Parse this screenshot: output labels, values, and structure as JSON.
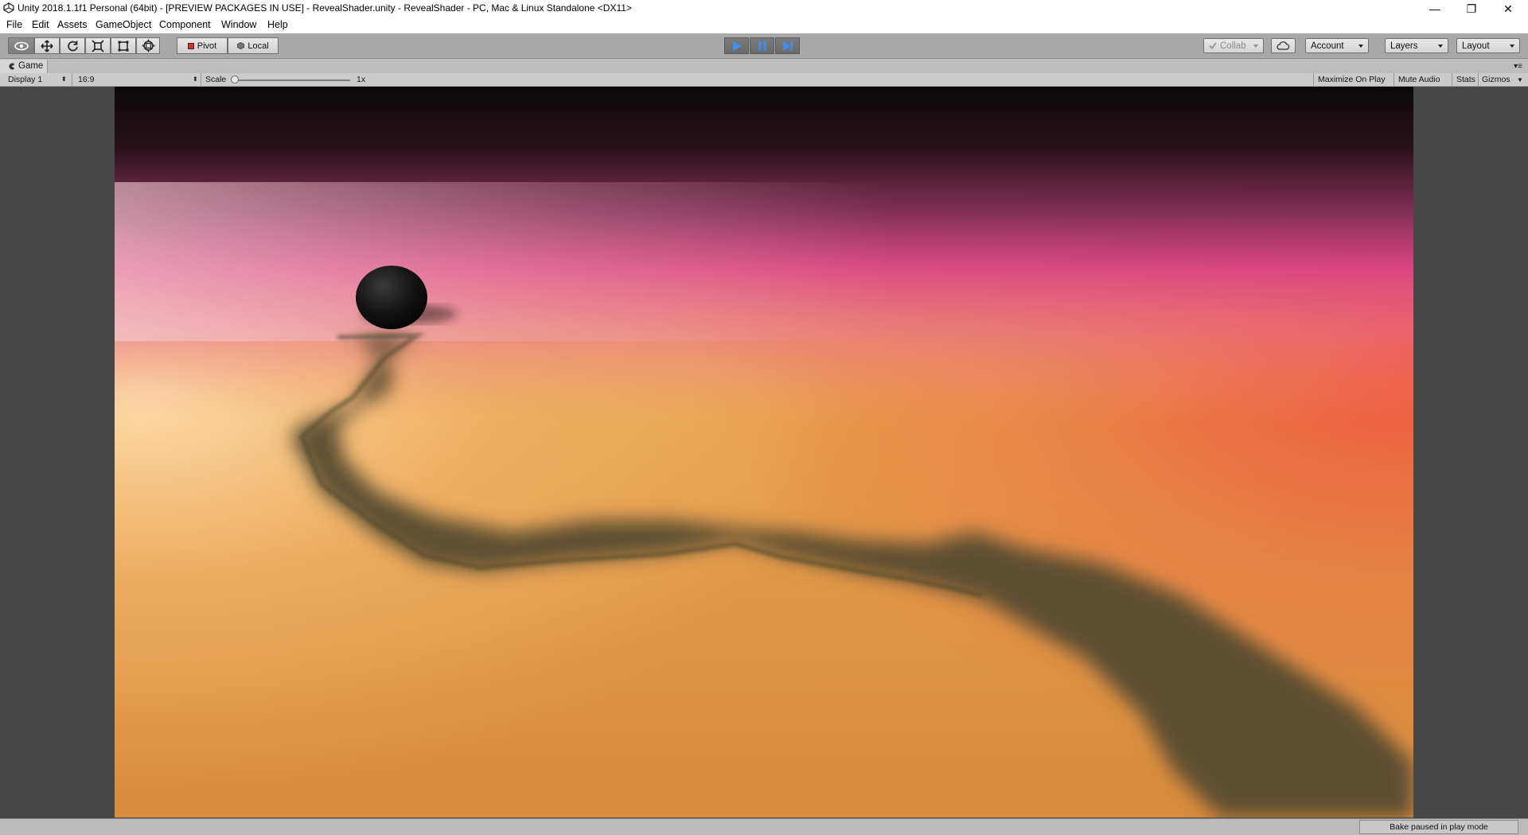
{
  "window": {
    "title": "Unity 2018.1.1f1 Personal (64bit) - [PREVIEW PACKAGES IN USE] - RevealShader.unity - RevealShader - PC, Mac & Linux Standalone <DX11>",
    "minimize_glyph": "—",
    "restore_glyph": "❐",
    "close_glyph": "✕"
  },
  "menu": {
    "file": "File",
    "edit": "Edit",
    "assets": "Assets",
    "gameobject": "GameObject",
    "component": "Component",
    "window": "Window",
    "help": "Help"
  },
  "toolbar": {
    "pivot": "Pivot",
    "local": "Local",
    "collab": "Collab",
    "account": "Account",
    "layers": "Layers",
    "layout": "Layout"
  },
  "game_panel": {
    "tab_label": "Game",
    "display": "Display 1",
    "aspect": "16:9",
    "scale_label": "Scale",
    "scale_value": "1x",
    "scale_level": 0,
    "maximize_on_play": "Maximize On Play",
    "mute_audio": "Mute Audio",
    "stats": "Stats",
    "gizmos": "Gizmos"
  },
  "status": {
    "bake": "Bake paused in play mode"
  },
  "colors": {
    "play_accent": "#2f7ad8",
    "sky_top": "#0e0b0c",
    "sky_magenta": "#d8408a",
    "ground_sun": "#f2a055",
    "ground_red": "#e84f3a",
    "trail": "#534a2f",
    "ball": "#121212"
  },
  "icons": {
    "view_tool": "eye-icon",
    "move_tool": "move-arrows-icon",
    "rotate_tool": "rotate-icon",
    "scale_tool": "scale-icon",
    "rect_tool": "rect-transform-icon",
    "transform_tool": "transform-icon",
    "play": "play-icon",
    "pause": "pause-icon",
    "step": "step-icon",
    "cloud": "cloud-icon"
  }
}
